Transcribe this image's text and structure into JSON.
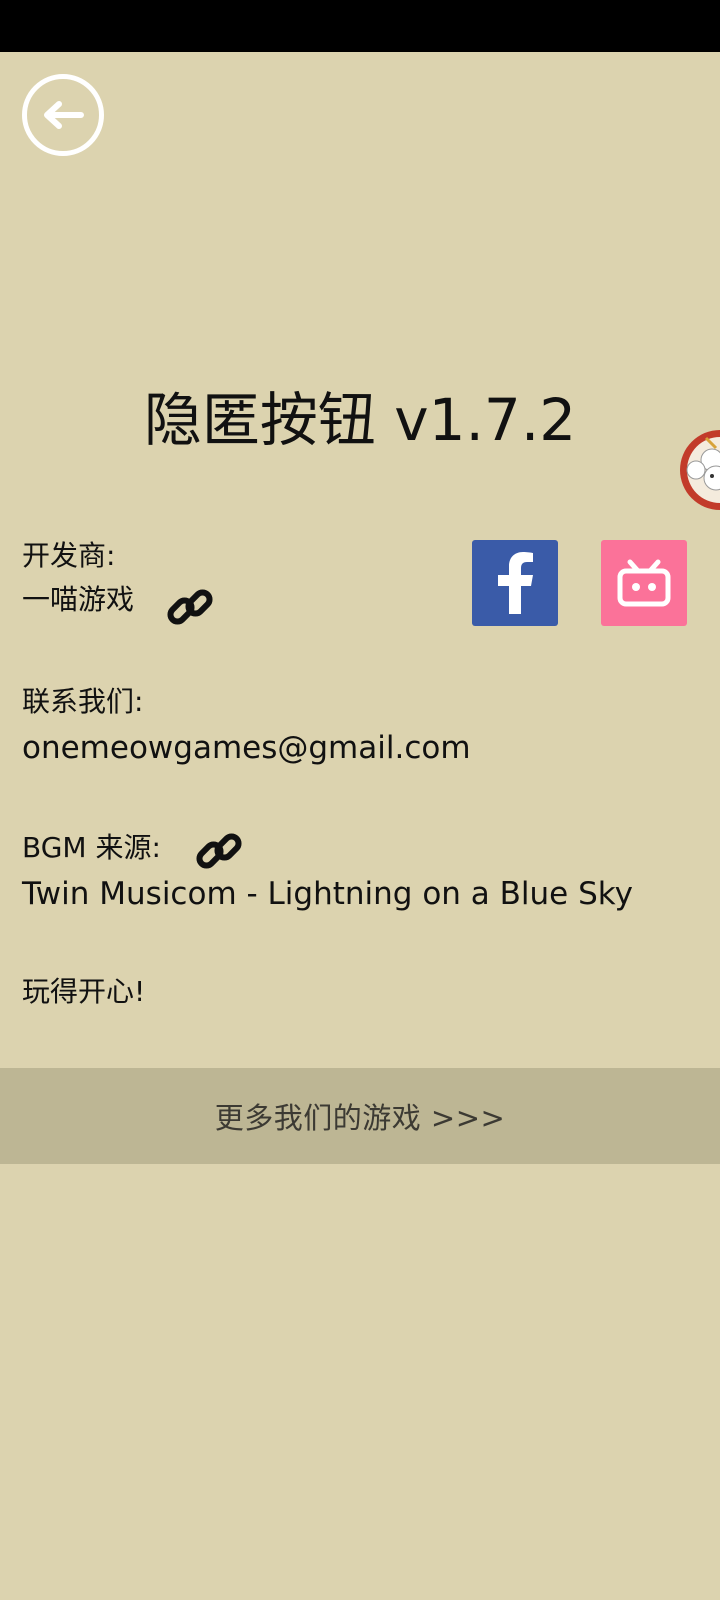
{
  "app": {
    "title": "隐匿按钮 v1.7.2"
  },
  "developer": {
    "label": "开发商:",
    "name": "一喵游戏"
  },
  "contact": {
    "label": "联系我们:",
    "email": "onemeowgames@gmail.com"
  },
  "bgm": {
    "label": "BGM 来源:",
    "track": "Twin Musicom - Lightning on a Blue Sky"
  },
  "closing": "玩得开心!",
  "more_games": "更多我们的游戏 >>>",
  "social": {
    "facebook": {
      "icon": "facebook-icon",
      "color": "#3A5BA8"
    },
    "bilibili": {
      "icon": "bilibili-icon",
      "color": "#FB7299"
    }
  },
  "colors": {
    "background": "#DCD3AF",
    "button_band": "#BDB694",
    "back_button": "#FFFFFF"
  }
}
